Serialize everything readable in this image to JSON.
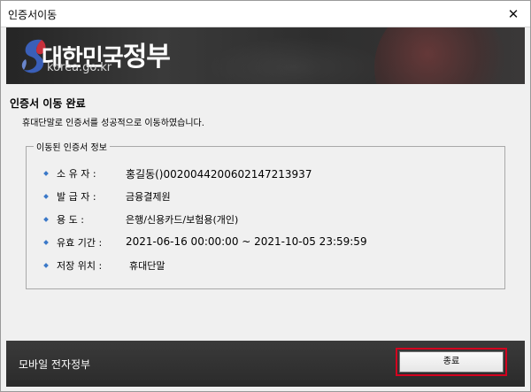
{
  "window": {
    "title": "인증서이동",
    "close_glyph": "✕"
  },
  "banner": {
    "logo_text_small": "대한민국",
    "logo_text_big": "정부",
    "logo_url": "korea.go.kr"
  },
  "main": {
    "heading": "인증서 이동 완료",
    "description": "휴대단말로 인증서를 성공적으로 이동하였습니다.",
    "group_title": "이동된 인증서 정보",
    "info_rows": [
      {
        "label": "소 유 자 :",
        "value": "홍길동()0020044200602147213937"
      },
      {
        "label": "발 급 자 :",
        "value": "금융결제원"
      },
      {
        "label": "용       도 :",
        "value": "은행/신용카드/보험용(개인)"
      },
      {
        "label": "유효 기간 :",
        "value": "2021-06-16 00:00:00 ~ 2021-10-05 23:59:59"
      },
      {
        "label": "저장 위치 :",
        "value": "휴대단말"
      }
    ]
  },
  "footer": {
    "brand": "모바일 전자정부",
    "close_button_label": "종료"
  },
  "colors": {
    "banner_dark": "#2e2e2e",
    "bullet_blue": "#3a78c8",
    "highlight_red": "#d4001f"
  }
}
